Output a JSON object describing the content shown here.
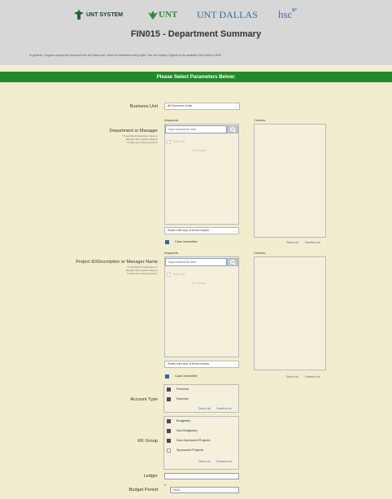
{
  "header": {
    "logos": [
      {
        "name": "UNT SYSTEM"
      },
      {
        "name": "UNT"
      },
      {
        "name": "UNT DALLAS"
      },
      {
        "name": "hsc"
      }
    ],
    "title": "FIN015 - Department Summary",
    "intro": "In general, Cognos reports are sourced from the Data mart, which is refreshed every night. You can expect Cognos to be available from 6AM to 8PM."
  },
  "banner": {
    "text": "Please Select Parameters Below:"
  },
  "business_unit": {
    "label": "Business Unit",
    "selected": "All Business Units"
  },
  "department": {
    "label": "Department or Manager",
    "note_lines": [
      "* If searching for Department Name or",
      "Manager Name, please change to",
      "\"Contains any of these keywords\""
    ],
    "keywords_label": "Keywords:",
    "placeholder": "Input keywords here",
    "select_all": "Select all",
    "no_results": "No Results",
    "match_mode": "Starts with any of these keywo",
    "case_insensitive": "Case insensitive",
    "choices_label": "Choices:",
    "select_all_link": "Select all",
    "deselect_all_link": "Deselect all"
  },
  "project": {
    "label": "Project ID/Description or Manager Name",
    "note_lines": [
      "* If searching for Project Name or",
      "Manager Name, please change to",
      "\"Contains any of these keywords\""
    ],
    "keywords_label": "Keywords:",
    "placeholder": "Input keywords here",
    "select_all": "Select all",
    "no_results": "No Results",
    "match_mode": "Starts with any of these keywo",
    "case_insensitive": "Case insensitive",
    "choices_label": "Choices:",
    "select_all_link": "Select all",
    "deselect_all_link": "Deselect all"
  },
  "account_type": {
    "label": "Account Type",
    "options": [
      "Revenue",
      "Expense"
    ],
    "select_all_link": "Select all",
    "deselect_all_link": "Deselect all"
  },
  "kk_group": {
    "label": "KK Group",
    "options": [
      "Budgetary",
      "Non-Budgetary",
      "Non-Sponsored Projects",
      "Sponsored Projects"
    ],
    "select_all_link": "Select all",
    "deselect_all_link": "Deselect all"
  },
  "ledger": {
    "label": "Ledger",
    "value": ""
  },
  "budget_period": {
    "label": "Budget Period",
    "required_mark": "*",
    "value": "2022"
  },
  "colors": {
    "banner": "#1f8a2a",
    "page": "#f3edd0",
    "header": "#d7d7d7",
    "link": "#4c6db3"
  },
  "icons": [
    "search-icon",
    "checkbox-icon",
    "chevron-down-icon"
  ]
}
